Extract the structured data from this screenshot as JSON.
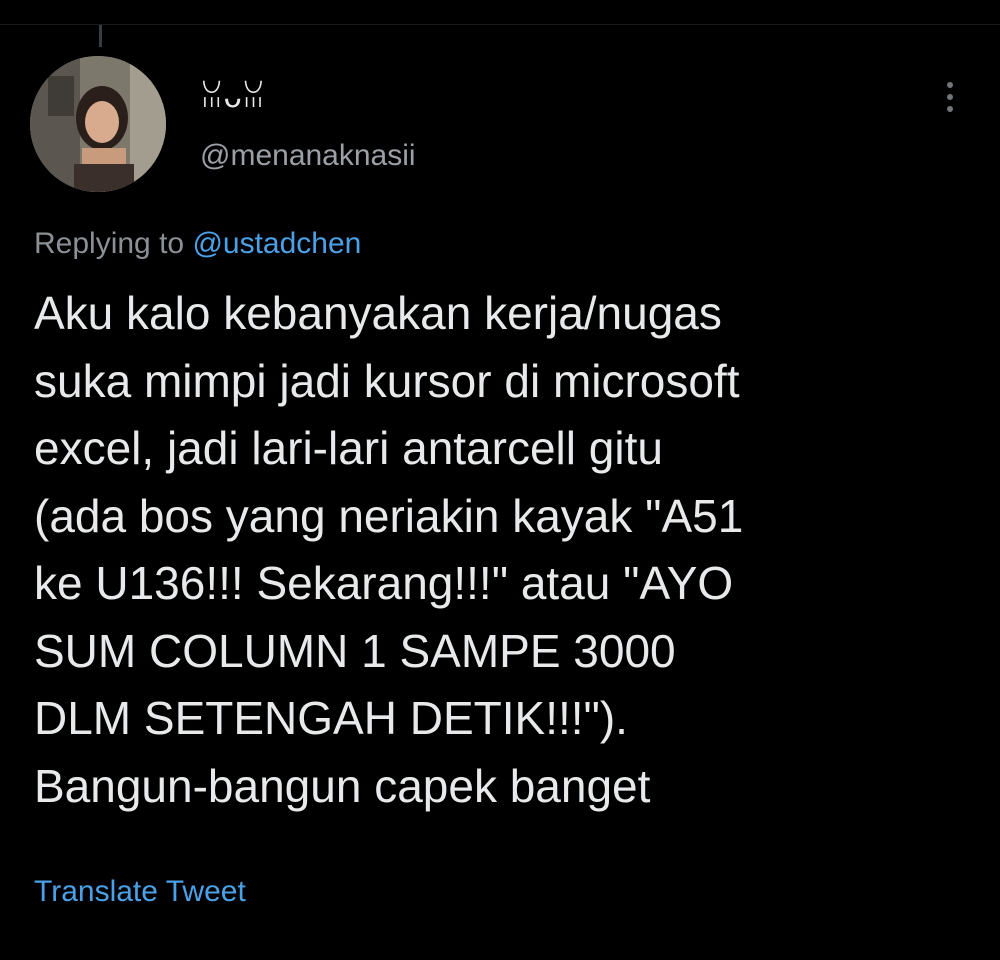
{
  "tweet": {
    "display_name": "ꈍᴗꈍ",
    "handle": "@menanaknasii",
    "replying_prefix": "Replying to",
    "replying_to": "@ustadchen",
    "body_lines": [
      "Aku kalo kebanyakan kerja/nugas",
      "suka mimpi jadi kursor di microsoft",
      "excel, jadi lari-lari antarcell gitu",
      "(ada bos yang neriakin kayak \"A51",
      "ke U136!!! Sekarang!!!\" atau \"AYO",
      "SUM COLUMN 1 SAMPE 3000",
      "DLM SETENGAH DETIK!!!\").",
      "Bangun-bangun capek banget"
    ],
    "translate_label": "Translate Tweet"
  },
  "icons": {
    "more": "more-vertical-icon"
  },
  "colors": {
    "background": "#000000",
    "text_primary": "#e7e9ea",
    "text_secondary": "#8b9096",
    "link": "#4ba1e8"
  }
}
